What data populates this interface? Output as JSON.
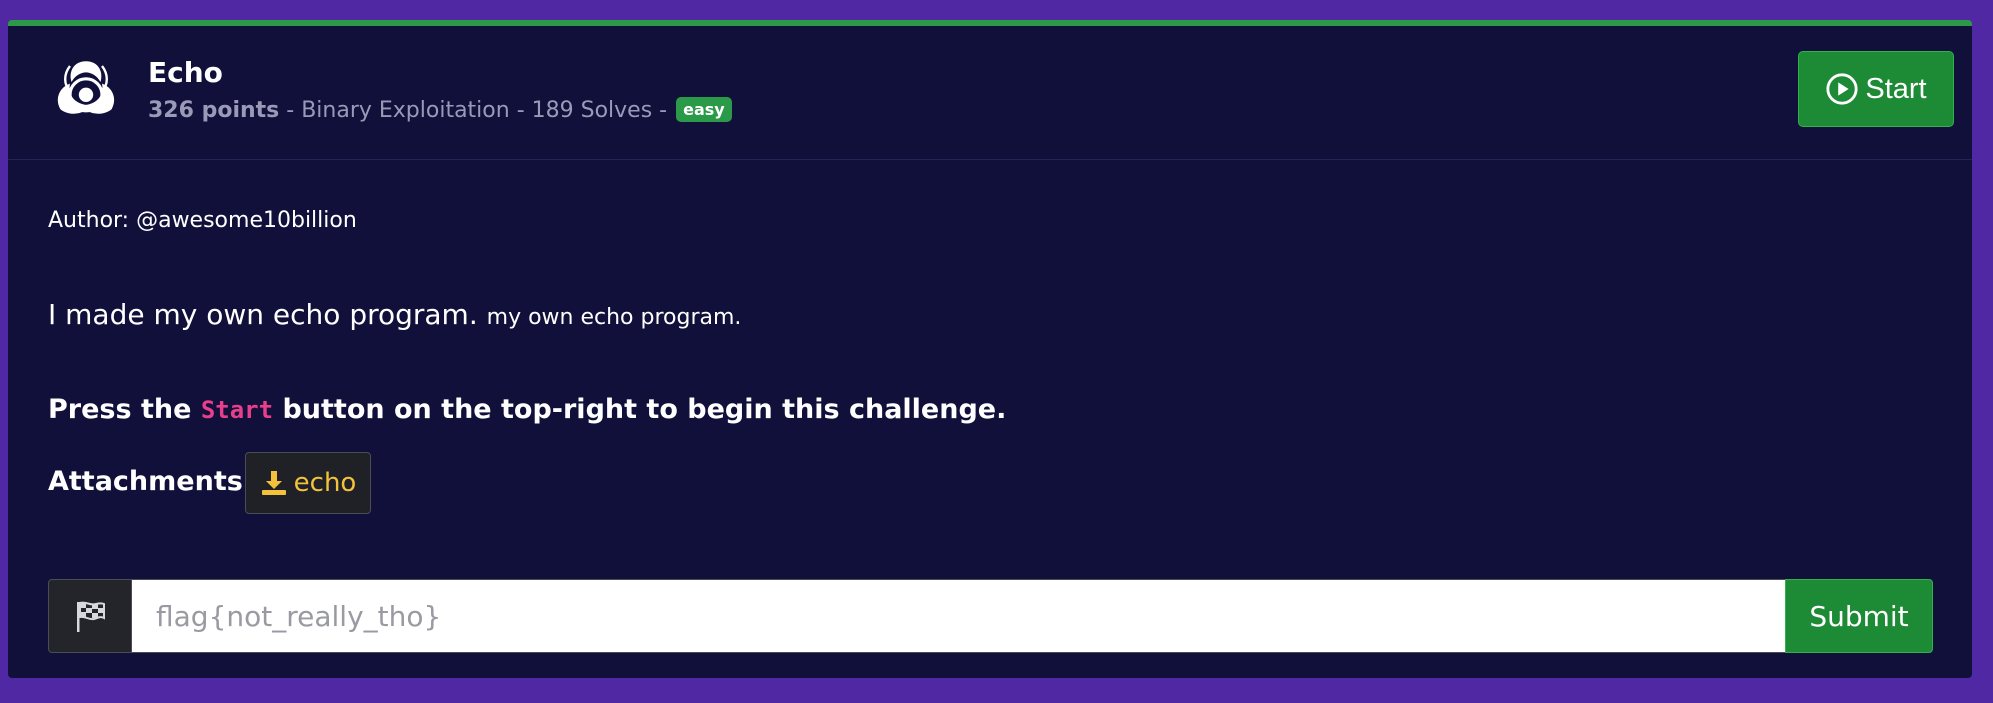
{
  "challenge": {
    "icon": "biohazard-icon",
    "title": "Echo",
    "points": "326 points",
    "category_text": " - Binary Exploitation - 189 Solves - ",
    "difficulty": "easy",
    "start_label": "Start",
    "start_icon": "play-circle-icon"
  },
  "body": {
    "author": "Author: @awesome10billion",
    "description_main": "I made my own echo program.",
    "description_small": "my own echo program.",
    "press_prefix": "Press the ",
    "press_code": "Start",
    "press_suffix": " button on the top-right to begin this challenge.",
    "attachments_label": "Attachments:",
    "attachment_name": "echo",
    "attachment_icon": "download-icon"
  },
  "flag_form": {
    "icon": "checkered-flag-icon",
    "placeholder": "flag{not_really_tho}",
    "submit_label": "Submit"
  },
  "colors": {
    "page_background": "#5128a3",
    "card_background": "#10103a",
    "accent_green": "#1d8a35",
    "code_pink": "#e83e8c",
    "attachment_yellow": "#f2c23c"
  }
}
